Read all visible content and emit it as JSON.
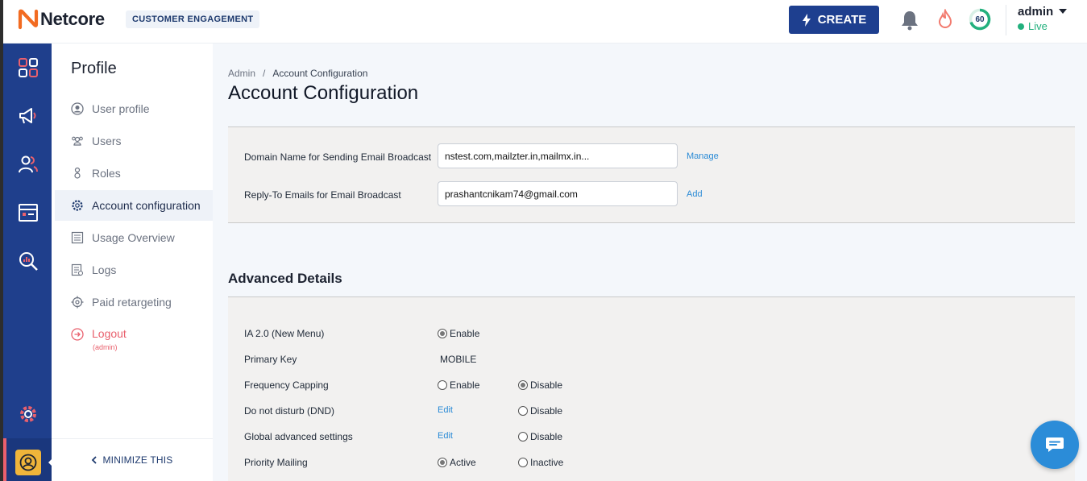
{
  "header": {
    "brand": "Netcore",
    "product": "CUSTOMER ENGAGEMENT",
    "create_label": "CREATE",
    "score": "60",
    "user": "admin",
    "status": "Live"
  },
  "rail": {
    "icons": [
      "dashboard-icon",
      "megaphone-icon",
      "users-icon",
      "calendar-icon",
      "analytics-search-icon",
      "settings-icon",
      "profile-avatar-icon"
    ]
  },
  "submenu": {
    "title": "Profile",
    "items": [
      {
        "label": "User profile",
        "icon": "user-circle-icon"
      },
      {
        "label": "Users",
        "icon": "users-icon"
      },
      {
        "label": "Roles",
        "icon": "roles-icon"
      },
      {
        "label": "Account configuration",
        "icon": "gear-icon",
        "active": true
      },
      {
        "label": "Usage Overview",
        "icon": "list-icon"
      },
      {
        "label": "Logs",
        "icon": "log-icon"
      },
      {
        "label": "Paid retargeting",
        "icon": "target-icon"
      }
    ],
    "logout": "Logout",
    "logout_sub": "(admin)",
    "minimize": "MINIMIZE THIS"
  },
  "main": {
    "breadcrumb_root": "Admin",
    "breadcrumb_sep": "/",
    "breadcrumb_current": "Account Configuration",
    "title": "Account Configuration",
    "email_settings": {
      "domain_label": "Domain Name for Sending Email Broadcast",
      "domain_value": "nstest.com,mailzter.in,mailmx.in...",
      "domain_link": "Manage",
      "reply_label": "Reply-To Emails for Email Broadcast",
      "reply_value": "prashantcnikam74@gmail.com",
      "reply_link": "Add"
    },
    "advanced_heading": "Advanced Details",
    "advanced": {
      "ia_label": "IA 2.0 (New Menu)",
      "ia_enable": "Enable",
      "primary_key_label": "Primary Key",
      "primary_key_value": "MOBILE",
      "freq_label": "Frequency Capping",
      "freq_enable": "Enable",
      "freq_disable": "Disable",
      "dnd_label": "Do not disturb (DND)",
      "dnd_edit": "Edit",
      "dnd_disable": "Disable",
      "global_label": "Global advanced settings",
      "global_edit": "Edit",
      "global_disable": "Disable",
      "priority_label": "Priority Mailing",
      "priority_active": "Active",
      "priority_inactive": "Inactive"
    }
  },
  "colors": {
    "rail": "#1f3f8c",
    "primary": "#1e3f8f",
    "link": "#2b8bd6",
    "live": "#22b07d",
    "logout": "#e9606d",
    "brand_orange": "#f26b21"
  }
}
